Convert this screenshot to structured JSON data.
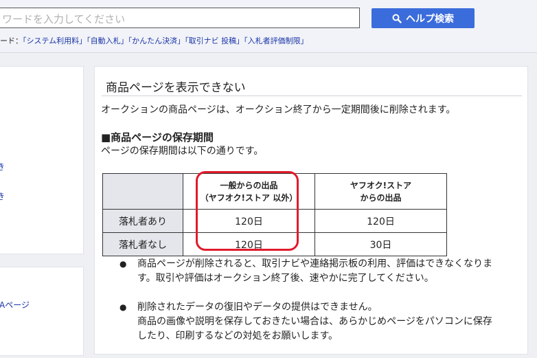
{
  "header": {
    "search_placeholder": "ワードを入力してください",
    "help_button_label": "ヘルプ検索",
    "keywords_prefix": "ード：",
    "keywords": [
      "「システム利用料」",
      "「自動入札」",
      "「かんたん決済」",
      "「取引ナビ 投稿」",
      "「入札者評価制限」"
    ]
  },
  "left_panel": {
    "fragments": [
      "き",
      "き",
      "、"
    ],
    "qa_link": "Aページ"
  },
  "article": {
    "title": "商品ページを表示できない",
    "intro": "オークションの商品ページは、オークション終了から一定期間後に削除されます。",
    "section_heading": "■商品ページの保存期間",
    "section_sub": "ページの保存期間は以下の通りです。",
    "table": {
      "headers": {
        "col1_line1": "一般からの出品",
        "col1_line2": "（ヤフオク!ストア 以外）",
        "col2_line1": "ヤフオク!ストア",
        "col2_line2": "からの出品"
      },
      "rows": [
        {
          "label": "落札者あり",
          "general": "120日",
          "store": "120日"
        },
        {
          "label": "落札者なし",
          "general": "120日",
          "store": "30日"
        }
      ]
    },
    "bullets": [
      {
        "mark": "●",
        "lines": [
          "商品ページが削除されると、取引ナビや連絡掲示板の利用、評価はできなくなりま",
          "す。取引や評価はオークション終了後、速やかに完了してください。"
        ]
      },
      {
        "mark": "●",
        "lines": [
          "削除されたデータの復旧やデータの提供はできません。",
          "商品の画像や説明を保存しておきたい場合は、あらかじめページをパソコンに保存",
          "したり、印刷するなどの対処をお願いします。"
        ]
      }
    ]
  },
  "colors": {
    "accent_button": "#3b6cdb",
    "highlight_border": "#e01b2b",
    "link": "#1a33a8"
  }
}
